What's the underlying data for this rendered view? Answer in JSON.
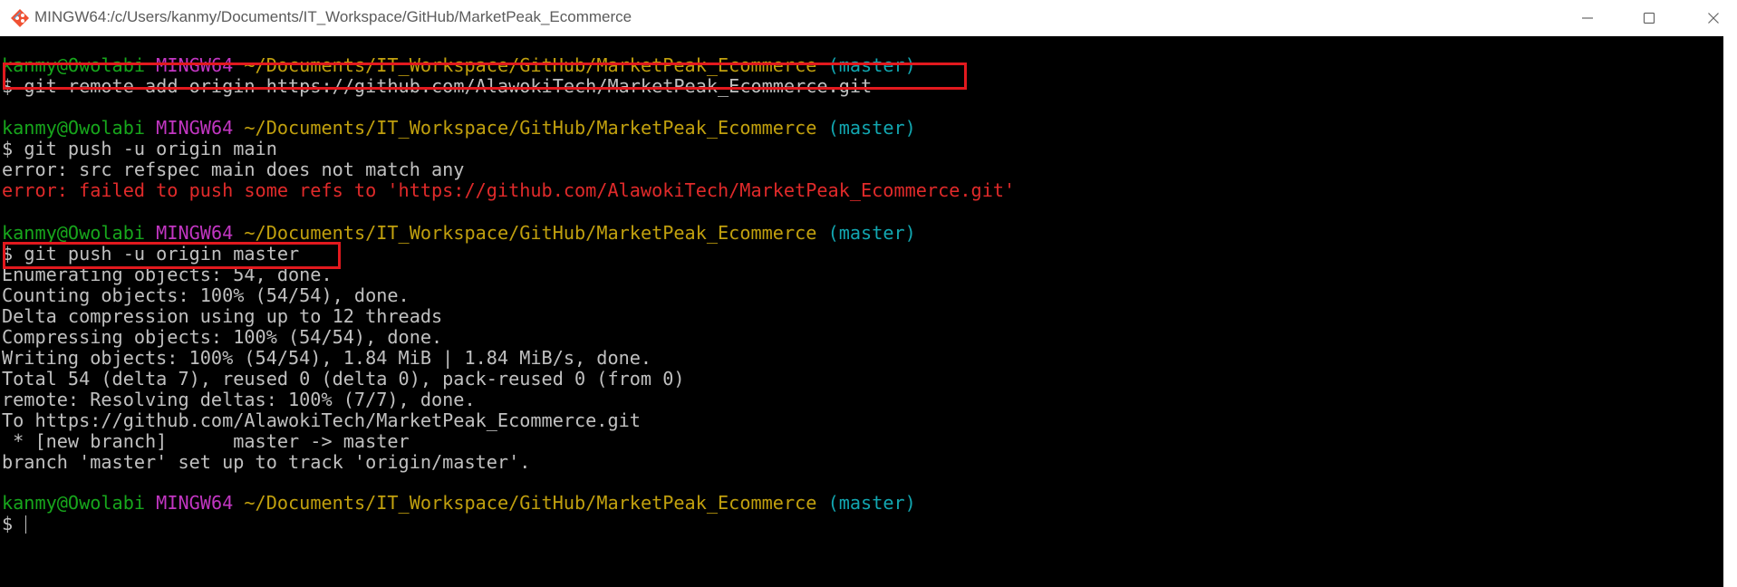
{
  "window": {
    "title": "MINGW64:/c/Users/kanmy/Documents/IT_Workspace/GitHub/MarketPeak_Ecommerce",
    "icon": "git-bash-icon",
    "controls": [
      "minimize-icon",
      "maximize-icon",
      "close-icon"
    ]
  },
  "colors": {
    "user": "#17a61c",
    "host": "#c236c2",
    "path": "#c1a00e",
    "branch": "#12a6b0",
    "error": "#e02a2a",
    "text": "#c0c0c0",
    "highlight": "#e2191e",
    "background": "#000000"
  },
  "prompt": {
    "user": "kanmy@Owolabi",
    "host": "MINGW64",
    "path": "~/Documents/IT_Workspace/GitHub/MarketPeak_Ecommerce",
    "branch": "(master)",
    "symbol": "$"
  },
  "commands": {
    "cmd1": "git remote add origin https://github.com/AlawokiTech/MarketPeak_Ecommerce.git",
    "cmd2": "git push -u origin main",
    "cmd3": "git push -u origin master"
  },
  "output": {
    "err1": "error: src refspec main does not match any",
    "err2": "error: failed to push some refs to 'https://github.com/AlawokiTech/MarketPeak_Ecommerce.git'",
    "push_lines": [
      "Enumerating objects: 54, done.",
      "Counting objects: 100% (54/54), done.",
      "Delta compression using up to 12 threads",
      "Compressing objects: 100% (54/54), done.",
      "Writing objects: 100% (54/54), 1.84 MiB | 1.84 MiB/s, done.",
      "Total 54 (delta 7), reused 0 (delta 0), pack-reused 0 (from 0)",
      "remote: Resolving deltas: 100% (7/7), done.",
      "To https://github.com/AlawokiTech/MarketPeak_Ecommerce.git",
      " * [new branch]      master -> master",
      "branch 'master' set up to track 'origin/master'."
    ]
  }
}
